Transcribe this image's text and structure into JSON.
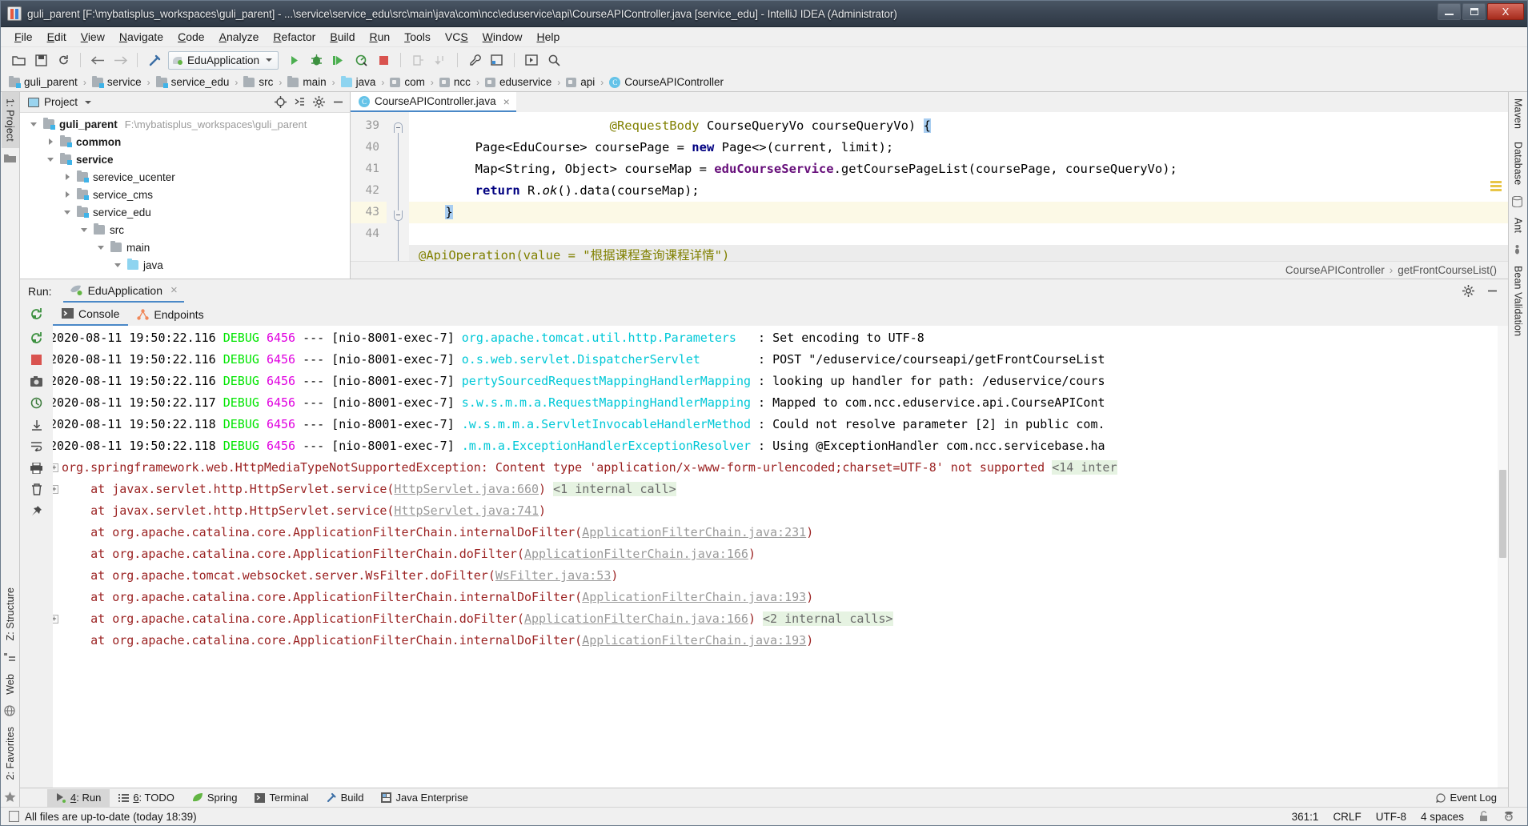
{
  "window": {
    "title": "guli_parent [F:\\mybatisplus_workspaces\\guli_parent] - ...\\service\\service_edu\\src\\main\\java\\com\\ncc\\eduservice\\api\\CourseAPIController.java [service_edu] - IntelliJ IDEA (Administrator)",
    "minimize_label": "",
    "maximize_label": "",
    "close_label": "X",
    "app_icon": "intellij-idea-icon"
  },
  "menubar": {
    "items": [
      {
        "label": "File",
        "mnemonic": "F"
      },
      {
        "label": "Edit",
        "mnemonic": "E"
      },
      {
        "label": "View",
        "mnemonic": "V"
      },
      {
        "label": "Navigate",
        "mnemonic": "N"
      },
      {
        "label": "Code",
        "mnemonic": "C"
      },
      {
        "label": "Analyze",
        "mnemonic": "A"
      },
      {
        "label": "Refactor",
        "mnemonic": "R"
      },
      {
        "label": "Build",
        "mnemonic": "B"
      },
      {
        "label": "Run",
        "mnemonic": "R"
      },
      {
        "label": "Tools",
        "mnemonic": "T"
      },
      {
        "label": "VCS",
        "mnemonic": "S"
      },
      {
        "label": "Window",
        "mnemonic": "W"
      },
      {
        "label": "Help",
        "mnemonic": "H"
      }
    ]
  },
  "toolbar": {
    "run_config": "EduApplication",
    "icons": [
      "open-project-icon",
      "save-all-icon",
      "sync-icon",
      "back-arrow-icon",
      "forward-arrow-icon",
      "build-hammer-icon",
      "run-icon",
      "debug-icon",
      "run-coverage-icon",
      "profile-icon",
      "stop-icon",
      "update-app-icon",
      "rerun-icon",
      "settings-wrench-icon",
      "project-structure-icon",
      "run-anything-icon",
      "search-everywhere-icon"
    ]
  },
  "breadcrumb": {
    "items": [
      {
        "label": "guli_parent",
        "icon": "module-folder-icon"
      },
      {
        "label": "service",
        "icon": "module-folder-icon"
      },
      {
        "label": "service_edu",
        "icon": "module-folder-icon"
      },
      {
        "label": "src",
        "icon": "folder-icon"
      },
      {
        "label": "main",
        "icon": "folder-icon"
      },
      {
        "label": "java",
        "icon": "source-folder-icon"
      },
      {
        "label": "com",
        "icon": "package-icon"
      },
      {
        "label": "ncc",
        "icon": "package-icon"
      },
      {
        "label": "eduservice",
        "icon": "package-icon"
      },
      {
        "label": "api",
        "icon": "package-icon"
      },
      {
        "label": "CourseAPIController",
        "icon": "java-class-icon"
      }
    ]
  },
  "left_rail": {
    "tabs": [
      {
        "label": "1: Project",
        "selected": true
      },
      {
        "label": "Z: Structure",
        "selected": false
      },
      {
        "label": "Web",
        "selected": false
      },
      {
        "label": "2: Favorites",
        "selected": false
      }
    ],
    "icons": [
      "project-folder-icon",
      "structure-icon",
      "web-globe-icon",
      "favorites-star-icon"
    ]
  },
  "right_rail": {
    "tabs": [
      {
        "label": "Maven"
      },
      {
        "label": "Database"
      },
      {
        "label": "Ant"
      },
      {
        "label": "Bean Validation"
      }
    ]
  },
  "project_pane": {
    "title": "Project",
    "header_icons": [
      "locate-target-icon",
      "collapse-all-icon",
      "gear-icon",
      "hide-icon"
    ],
    "tree": [
      {
        "depth": 0,
        "twisty": "down",
        "icon": "module-folder-icon",
        "label": "guli_parent",
        "bold": true,
        "path": "F:\\mybatisplus_workspaces\\guli_parent"
      },
      {
        "depth": 1,
        "twisty": "right",
        "icon": "module-folder-icon",
        "label": "common",
        "bold": true,
        "path": ""
      },
      {
        "depth": 1,
        "twisty": "down",
        "icon": "module-folder-icon",
        "label": "service",
        "bold": true,
        "path": ""
      },
      {
        "depth": 2,
        "twisty": "right",
        "icon": "module-folder-icon",
        "label": "serevice_ucenter",
        "bold": false,
        "path": ""
      },
      {
        "depth": 2,
        "twisty": "right",
        "icon": "module-folder-icon",
        "label": "service_cms",
        "bold": false,
        "path": ""
      },
      {
        "depth": 2,
        "twisty": "down",
        "icon": "module-folder-icon",
        "label": "service_edu",
        "bold": false,
        "path": ""
      },
      {
        "depth": 3,
        "twisty": "down",
        "icon": "folder-icon",
        "label": "src",
        "bold": false,
        "path": ""
      },
      {
        "depth": 4,
        "twisty": "down",
        "icon": "folder-icon",
        "label": "main",
        "bold": false,
        "path": ""
      },
      {
        "depth": 5,
        "twisty": "down",
        "icon": "source-folder-icon",
        "label": "java",
        "bold": false,
        "path": ""
      }
    ]
  },
  "editor": {
    "tab": {
      "label": "CourseAPIController.java",
      "icon": "java-class-icon",
      "close": "×"
    },
    "line_numbers": [
      "39",
      "40",
      "41",
      "42",
      "43",
      "44"
    ],
    "highlighted_line": "43",
    "lines": [
      {
        "num": "39",
        "indent": 26,
        "parts": [
          {
            "t": "@RequestBody ",
            "c": "ann"
          },
          {
            "t": "CourseQueryVo courseQueryVo) ",
            "c": "txt"
          },
          {
            "t": "{",
            "c": "brace"
          }
        ]
      },
      {
        "num": "40",
        "indent": 8,
        "parts": [
          {
            "t": "Page<EduCourse> coursePage = ",
            "c": "txt"
          },
          {
            "t": "new",
            "c": "kw"
          },
          {
            "t": " Page<>(current, limit);",
            "c": "txt"
          }
        ]
      },
      {
        "num": "41",
        "indent": 8,
        "parts": [
          {
            "t": "Map<String, Object> courseMap = ",
            "c": "txt"
          },
          {
            "t": "eduCourseService",
            "c": "fld"
          },
          {
            "t": ".getCoursePageList(coursePage, courseQueryVo);",
            "c": "txt"
          }
        ]
      },
      {
        "num": "42",
        "indent": 8,
        "parts": [
          {
            "t": "return",
            "c": "kw"
          },
          {
            "t": " R.",
            "c": "txt"
          },
          {
            "t": "ok",
            "c": "it"
          },
          {
            "t": "().data(courseMap);",
            "c": "txt"
          }
        ]
      },
      {
        "num": "43",
        "indent": 4,
        "parts": [
          {
            "t": "}",
            "c": "brace"
          }
        ]
      },
      {
        "num": "44",
        "indent": 0,
        "parts": []
      }
    ],
    "partial_top_line": "",
    "partial_bottom_line": "@ApiOperation(value = \"根据课程查询课程详情\")",
    "breadcrumb_bottom": [
      "CourseAPIController",
      "getFrontCourseList()"
    ]
  },
  "run_panel": {
    "label": "Run:",
    "config_name": "EduApplication",
    "config_icon": "spring-boot-run-icon",
    "close_icon": "×",
    "header_icons": [
      "gear-icon",
      "hide-icon"
    ],
    "tabs": [
      {
        "label": "Console",
        "icon": "console-icon",
        "selected": true
      },
      {
        "label": "Endpoints",
        "icon": "endpoints-icon",
        "selected": false
      }
    ],
    "rail_icons": [
      "rerun-icon",
      "stop-icon",
      "screenshot-icon",
      "dump-threads-icon",
      "scroll-to-end-icon",
      "soft-wrap-icon",
      "print-icon",
      "clear-all-icon",
      "pin-icon"
    ],
    "scroll_arrows": [
      "up-arrow-icon",
      "down-arrow-icon"
    ]
  },
  "console": {
    "log_lines": [
      {
        "type": "log",
        "date": "2020-08-11 19:50:22.116",
        "level": "DEBUG",
        "pid": "6456",
        "sep": "---",
        "thread": "[nio-8001-exec-7]",
        "logger": "org.apache.tomcat.util.http.Parameters",
        "colon": ":",
        "message": "Set encoding to UTF-8"
      },
      {
        "type": "log",
        "date": "2020-08-11 19:50:22.116",
        "level": "DEBUG",
        "pid": "6456",
        "sep": "---",
        "thread": "[nio-8001-exec-7]",
        "logger": "o.s.web.servlet.DispatcherServlet",
        "colon": ":",
        "message": "POST \"/eduservice/courseapi/getFrontCourseList"
      },
      {
        "type": "log",
        "date": "2020-08-11 19:50:22.116",
        "level": "DEBUG",
        "pid": "6456",
        "sep": "---",
        "thread": "[nio-8001-exec-7]",
        "logger": "pertySourcedRequestMappingHandlerMapping",
        "colon": ":",
        "message": "looking up handler for path: /eduservice/cours"
      },
      {
        "type": "log",
        "date": "2020-08-11 19:50:22.117",
        "level": "DEBUG",
        "pid": "6456",
        "sep": "---",
        "thread": "[nio-8001-exec-7]",
        "logger": "s.w.s.m.m.a.RequestMappingHandlerMapping",
        "colon": ":",
        "message": "Mapped to com.ncc.eduservice.api.CourseAPICont"
      },
      {
        "type": "log",
        "date": "2020-08-11 19:50:22.118",
        "level": "DEBUG",
        "pid": "6456",
        "sep": "---",
        "thread": "[nio-8001-exec-7]",
        "logger": ".w.s.m.m.a.ServletInvocableHandlerMethod",
        "colon": ":",
        "message": "Could not resolve parameter [2] in public com."
      },
      {
        "type": "log",
        "date": "2020-08-11 19:50:22.118",
        "level": "DEBUG",
        "pid": "6456",
        "sep": "---",
        "thread": "[nio-8001-exec-7]",
        "logger": ".m.m.a.ExceptionHandlerExceptionResolver",
        "colon": ":",
        "message": "Using @ExceptionHandler com.ncc.servicebase.ha"
      }
    ],
    "exception_header": {
      "expander": "+",
      "text": "org.springframework.web.HttpMediaTypeNotSupportedException: Content type 'application/x-www-form-urlencoded;charset=UTF-8' not supported",
      "badge": "<14 inter"
    },
    "stack_frames": [
      {
        "expander": "+",
        "prefix": "at javax.servlet.http.HttpServlet.service(",
        "link": "HttpServlet.java:660",
        "suffix": ")",
        "badge": "<1 internal call>"
      },
      {
        "expander": "",
        "prefix": "at javax.servlet.http.HttpServlet.service(",
        "link": "HttpServlet.java:741",
        "suffix": ")",
        "badge": ""
      },
      {
        "expander": "",
        "prefix": "at org.apache.catalina.core.ApplicationFilterChain.internalDoFilter(",
        "link": "ApplicationFilterChain.java:231",
        "suffix": ")",
        "badge": ""
      },
      {
        "expander": "",
        "prefix": "at org.apache.catalina.core.ApplicationFilterChain.doFilter(",
        "link": "ApplicationFilterChain.java:166",
        "suffix": ")",
        "badge": ""
      },
      {
        "expander": "",
        "prefix": "at org.apache.tomcat.websocket.server.WsFilter.doFilter(",
        "link": "WsFilter.java:53",
        "suffix": ")",
        "badge": ""
      },
      {
        "expander": "",
        "prefix": "at org.apache.catalina.core.ApplicationFilterChain.internalDoFilter(",
        "link": "ApplicationFilterChain.java:193",
        "suffix": ")",
        "badge": ""
      },
      {
        "expander": "+",
        "prefix": "at org.apache.catalina.core.ApplicationFilterChain.doFilter(",
        "link": "ApplicationFilterChain.java:166",
        "suffix": ")",
        "badge": "<2 internal calls>"
      },
      {
        "expander": "",
        "prefix": "at org.apache.catalina.core.ApplicationFilterChain.internalDoFilter(",
        "link": "ApplicationFilterChain.java:193",
        "suffix": ")",
        "badge": ""
      }
    ]
  },
  "bottom_tabs": {
    "items": [
      {
        "label": "4: Run",
        "mnemonic": "4",
        "icon": "run-icon",
        "selected": true
      },
      {
        "label": "6: TODO",
        "mnemonic": "6",
        "icon": "todo-icon",
        "selected": false
      },
      {
        "label": "Spring",
        "mnemonic": "",
        "icon": "spring-leaf-icon",
        "selected": false
      },
      {
        "label": "Terminal",
        "mnemonic": "",
        "icon": "terminal-icon",
        "selected": false
      },
      {
        "label": "Build",
        "mnemonic": "",
        "icon": "build-hammer-icon",
        "selected": false
      },
      {
        "label": "Java Enterprise",
        "mnemonic": "",
        "icon": "java-enterprise-icon",
        "selected": false
      }
    ],
    "event_log": {
      "label": "Event Log",
      "icon": "event-log-icon"
    }
  },
  "statusbar": {
    "message": "All files are up-to-date (today 18:39)",
    "message_icon": "file-status-icon",
    "caret_position": "361:1",
    "line_separator": "CRLF",
    "encoding": "UTF-8",
    "indent": "4 spaces",
    "lock_icon": "unlocked-icon",
    "inspector_icon": "hector-inspection-icon"
  },
  "colors": {
    "accent_blue": "#4a88c7",
    "debug_green": "#00e500",
    "pid_magenta": "#e000e0",
    "logger_cyan": "#00c8d7",
    "error_red": "#9b2222",
    "titlebar": "#3b4654"
  }
}
